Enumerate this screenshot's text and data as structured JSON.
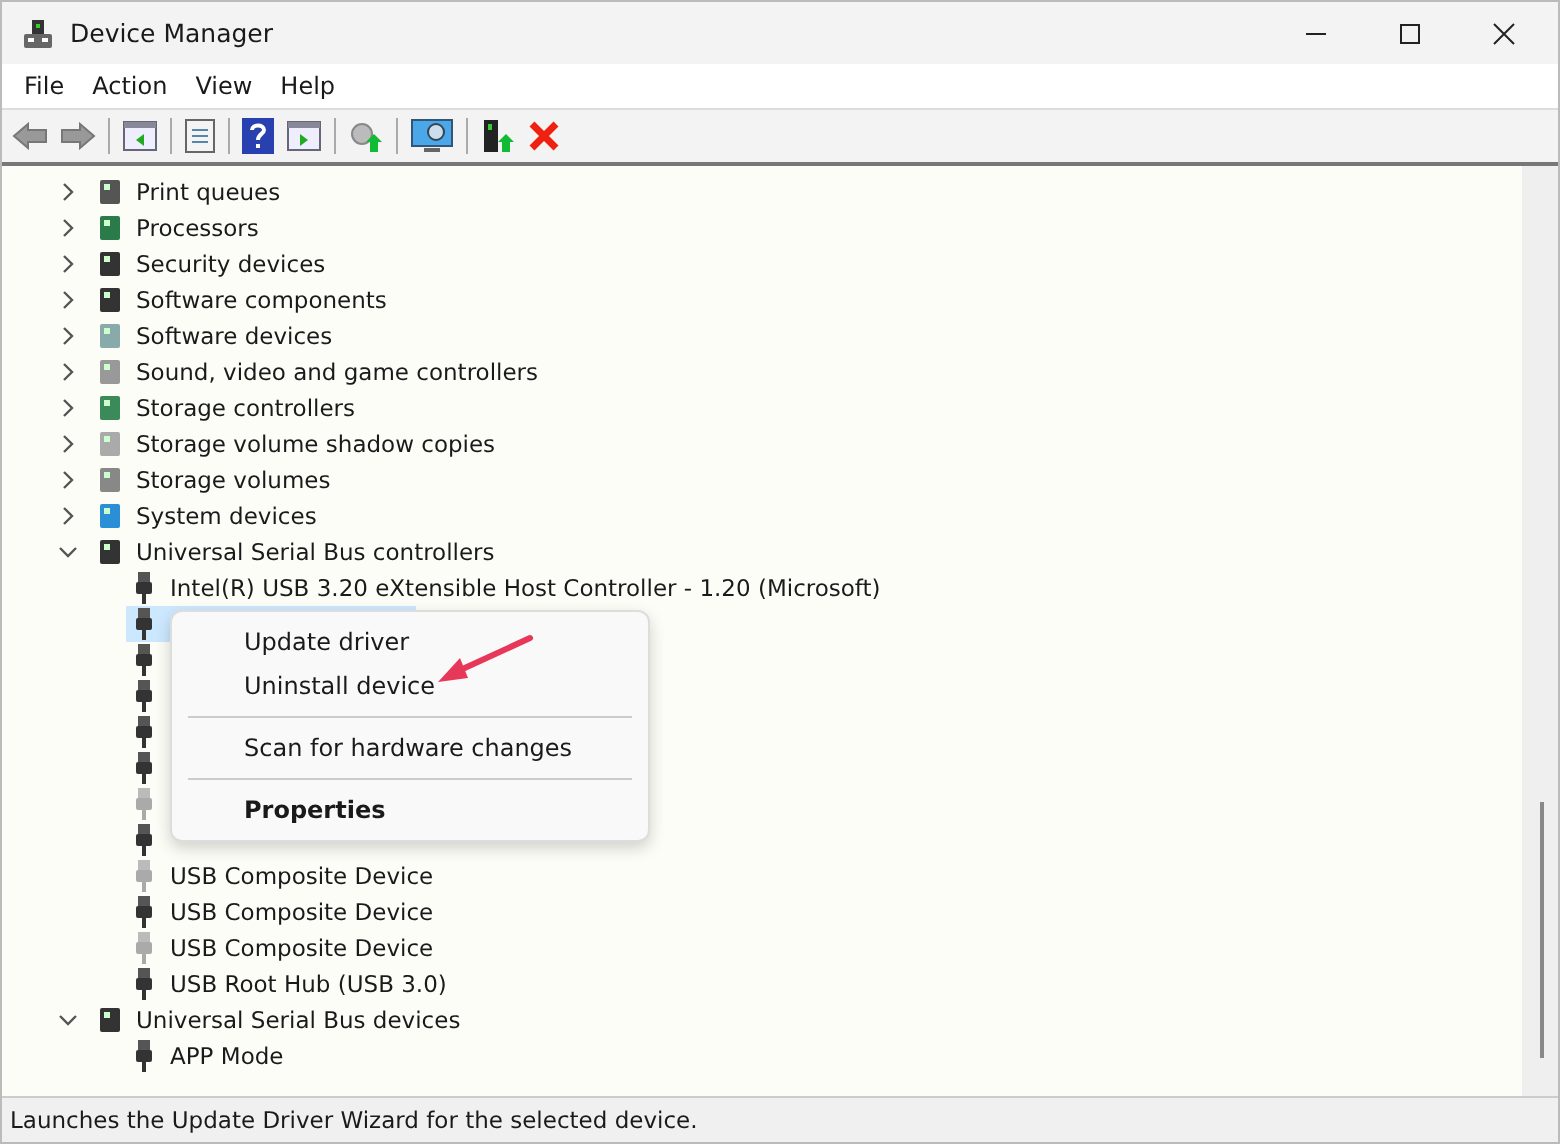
{
  "window": {
    "title": "Device Manager"
  },
  "menu_bar": [
    "File",
    "Action",
    "View",
    "Help"
  ],
  "tree": [
    {
      "label": "Print queues",
      "expanded": false
    },
    {
      "label": "Processors",
      "expanded": false
    },
    {
      "label": "Security devices",
      "expanded": false
    },
    {
      "label": "Software components",
      "expanded": false
    },
    {
      "label": "Software devices",
      "expanded": false
    },
    {
      "label": "Sound, video and game controllers",
      "expanded": false
    },
    {
      "label": "Storage controllers",
      "expanded": false
    },
    {
      "label": "Storage volume shadow copies",
      "expanded": false
    },
    {
      "label": "Storage volumes",
      "expanded": false
    },
    {
      "label": "System devices",
      "expanded": false
    },
    {
      "label": "Universal Serial Bus controllers",
      "expanded": true,
      "children": [
        {
          "label": "Intel(R) USB 3.20 eXtensible Host Controller - 1.20 (Microsoft)",
          "disabled": false,
          "selected": false
        },
        {
          "disabled": false,
          "selected": true
        },
        {
          "disabled": false,
          "selected": false
        },
        {
          "disabled": false,
          "selected": false
        },
        {
          "disabled": false,
          "selected": false
        },
        {
          "disabled": false,
          "selected": false
        },
        {
          "disabled": true,
          "selected": false
        },
        {
          "disabled": false,
          "selected": false
        },
        {
          "label": "USB Composite Device",
          "disabled": true,
          "selected": false
        },
        {
          "label": "USB Composite Device",
          "disabled": false,
          "selected": false
        },
        {
          "label": "USB Composite Device",
          "disabled": true,
          "selected": false
        },
        {
          "label": "USB Root Hub (USB 3.0)",
          "disabled": false,
          "selected": false
        }
      ]
    },
    {
      "label": "Universal Serial Bus devices",
      "expanded": true,
      "children": [
        {
          "label": "APP Mode",
          "disabled": false,
          "selected": false
        }
      ]
    }
  ],
  "context_menu": [
    {
      "label": "Update driver",
      "kind": "item"
    },
    {
      "label": "Uninstall device",
      "kind": "item"
    },
    {
      "kind": "separator"
    },
    {
      "label": "Scan for hardware changes",
      "kind": "item"
    },
    {
      "kind": "separator"
    },
    {
      "label": "Properties",
      "kind": "default"
    }
  ],
  "status_bar": "Launches the Update Driver Wizard for the selected device."
}
